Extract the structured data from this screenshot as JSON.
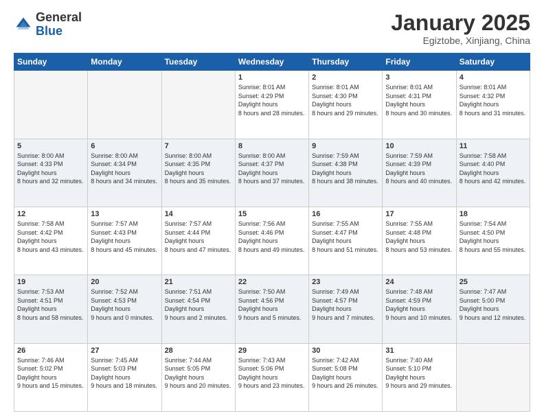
{
  "header": {
    "logo_general": "General",
    "logo_blue": "Blue",
    "month_title": "January 2025",
    "location": "Egiztobe, Xinjiang, China"
  },
  "days_of_week": [
    "Sunday",
    "Monday",
    "Tuesday",
    "Wednesday",
    "Thursday",
    "Friday",
    "Saturday"
  ],
  "weeks": [
    [
      {
        "num": "",
        "empty": true
      },
      {
        "num": "",
        "empty": true
      },
      {
        "num": "",
        "empty": true
      },
      {
        "num": "1",
        "sunrise": "8:01 AM",
        "sunset": "4:29 PM",
        "daylight": "8 hours and 28 minutes."
      },
      {
        "num": "2",
        "sunrise": "8:01 AM",
        "sunset": "4:30 PM",
        "daylight": "8 hours and 29 minutes."
      },
      {
        "num": "3",
        "sunrise": "8:01 AM",
        "sunset": "4:31 PM",
        "daylight": "8 hours and 30 minutes."
      },
      {
        "num": "4",
        "sunrise": "8:01 AM",
        "sunset": "4:32 PM",
        "daylight": "8 hours and 31 minutes."
      }
    ],
    [
      {
        "num": "5",
        "sunrise": "8:00 AM",
        "sunset": "4:33 PM",
        "daylight": "8 hours and 32 minutes."
      },
      {
        "num": "6",
        "sunrise": "8:00 AM",
        "sunset": "4:34 PM",
        "daylight": "8 hours and 34 minutes."
      },
      {
        "num": "7",
        "sunrise": "8:00 AM",
        "sunset": "4:35 PM",
        "daylight": "8 hours and 35 minutes."
      },
      {
        "num": "8",
        "sunrise": "8:00 AM",
        "sunset": "4:37 PM",
        "daylight": "8 hours and 37 minutes."
      },
      {
        "num": "9",
        "sunrise": "7:59 AM",
        "sunset": "4:38 PM",
        "daylight": "8 hours and 38 minutes."
      },
      {
        "num": "10",
        "sunrise": "7:59 AM",
        "sunset": "4:39 PM",
        "daylight": "8 hours and 40 minutes."
      },
      {
        "num": "11",
        "sunrise": "7:58 AM",
        "sunset": "4:40 PM",
        "daylight": "8 hours and 42 minutes."
      }
    ],
    [
      {
        "num": "12",
        "sunrise": "7:58 AM",
        "sunset": "4:42 PM",
        "daylight": "8 hours and 43 minutes."
      },
      {
        "num": "13",
        "sunrise": "7:57 AM",
        "sunset": "4:43 PM",
        "daylight": "8 hours and 45 minutes."
      },
      {
        "num": "14",
        "sunrise": "7:57 AM",
        "sunset": "4:44 PM",
        "daylight": "8 hours and 47 minutes."
      },
      {
        "num": "15",
        "sunrise": "7:56 AM",
        "sunset": "4:46 PM",
        "daylight": "8 hours and 49 minutes."
      },
      {
        "num": "16",
        "sunrise": "7:55 AM",
        "sunset": "4:47 PM",
        "daylight": "8 hours and 51 minutes."
      },
      {
        "num": "17",
        "sunrise": "7:55 AM",
        "sunset": "4:48 PM",
        "daylight": "8 hours and 53 minutes."
      },
      {
        "num": "18",
        "sunrise": "7:54 AM",
        "sunset": "4:50 PM",
        "daylight": "8 hours and 55 minutes."
      }
    ],
    [
      {
        "num": "19",
        "sunrise": "7:53 AM",
        "sunset": "4:51 PM",
        "daylight": "8 hours and 58 minutes."
      },
      {
        "num": "20",
        "sunrise": "7:52 AM",
        "sunset": "4:53 PM",
        "daylight": "9 hours and 0 minutes."
      },
      {
        "num": "21",
        "sunrise": "7:51 AM",
        "sunset": "4:54 PM",
        "daylight": "9 hours and 2 minutes."
      },
      {
        "num": "22",
        "sunrise": "7:50 AM",
        "sunset": "4:56 PM",
        "daylight": "9 hours and 5 minutes."
      },
      {
        "num": "23",
        "sunrise": "7:49 AM",
        "sunset": "4:57 PM",
        "daylight": "9 hours and 7 minutes."
      },
      {
        "num": "24",
        "sunrise": "7:48 AM",
        "sunset": "4:59 PM",
        "daylight": "9 hours and 10 minutes."
      },
      {
        "num": "25",
        "sunrise": "7:47 AM",
        "sunset": "5:00 PM",
        "daylight": "9 hours and 12 minutes."
      }
    ],
    [
      {
        "num": "26",
        "sunrise": "7:46 AM",
        "sunset": "5:02 PM",
        "daylight": "9 hours and 15 minutes."
      },
      {
        "num": "27",
        "sunrise": "7:45 AM",
        "sunset": "5:03 PM",
        "daylight": "9 hours and 18 minutes."
      },
      {
        "num": "28",
        "sunrise": "7:44 AM",
        "sunset": "5:05 PM",
        "daylight": "9 hours and 20 minutes."
      },
      {
        "num": "29",
        "sunrise": "7:43 AM",
        "sunset": "5:06 PM",
        "daylight": "9 hours and 23 minutes."
      },
      {
        "num": "30",
        "sunrise": "7:42 AM",
        "sunset": "5:08 PM",
        "daylight": "9 hours and 26 minutes."
      },
      {
        "num": "31",
        "sunrise": "7:40 AM",
        "sunset": "5:10 PM",
        "daylight": "9 hours and 29 minutes."
      },
      {
        "num": "",
        "empty": true
      }
    ]
  ],
  "labels": {
    "sunrise": "Sunrise:",
    "sunset": "Sunset:",
    "daylight": "Daylight hours"
  }
}
